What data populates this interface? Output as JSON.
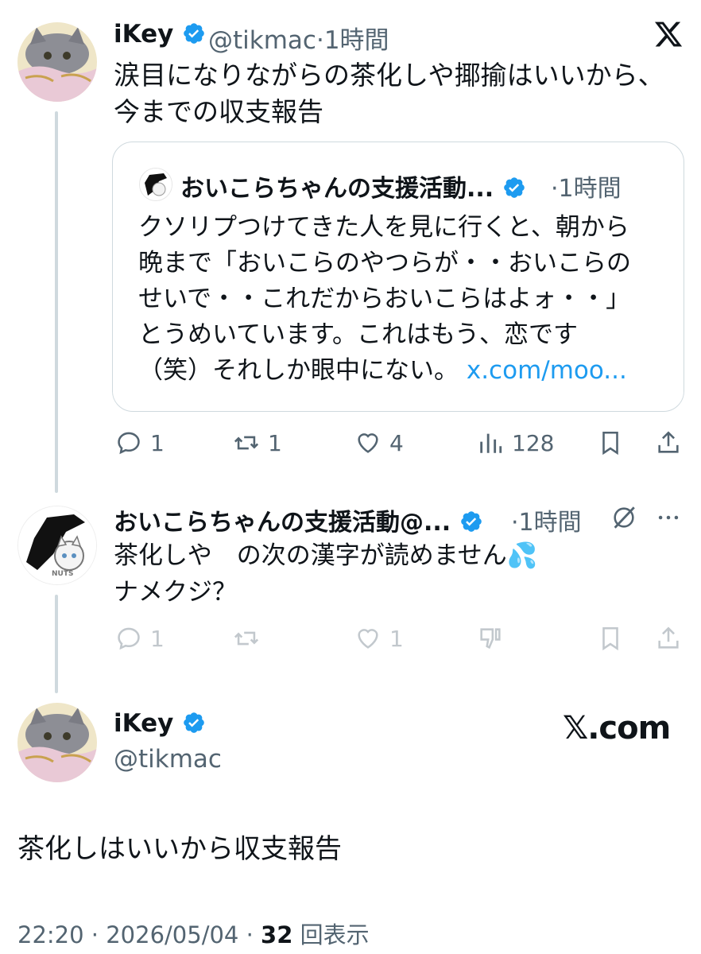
{
  "colors": {
    "verified": "#1d9bf0",
    "text": "#0f1419",
    "muted": "#536471",
    "link": "#1d9bf0",
    "thread_line": "#cfd9de"
  },
  "tweet1": {
    "name": "iKey",
    "handle": "@tikmac",
    "time": "·1時間",
    "text_line1": "涙目になりながらの茶化しや揶揄はいいから、",
    "text_line2": "今までの収支報告",
    "quote": {
      "name": "おいこらちゃんの支援活動...",
      "time": "·1時間",
      "line1": "クソリプつけてきた人を見に行くと、朝から",
      "line2": "晩まで「おいこらのやつらが・・おいこらの",
      "line3": "せいで・・これだからおいこらはよォ・・」",
      "line4": "とうめいています。これはもう、恋です",
      "line5": "（笑）それしか眼中にない。",
      "link": "x.com/moo..."
    },
    "actions": {
      "replies": "1",
      "retweets": "1",
      "likes": "4",
      "views": "128"
    }
  },
  "tweet2": {
    "name": "おいこらちゃんの支援活動@...",
    "time": "·1時間",
    "text_line1": "茶化しや　の次の漢字が読めません💦",
    "text_line2": "ナメクジ？",
    "avatar_label": "NUTS",
    "actions": {
      "replies": "1",
      "likes": "1"
    }
  },
  "tweet3": {
    "name": "iKey",
    "handle": "@tikmac",
    "brand": "𝕏.com",
    "text": "茶化しはいいから収支報告",
    "timestamp": "22:20 · 2026/05/04 · ",
    "views_count": "32",
    "views_label": " 回表示"
  },
  "icons": [
    "x-logo-icon",
    "verified-badge-icon",
    "reply-icon",
    "retweet-icon",
    "like-icon",
    "views-icon",
    "bookmark-icon",
    "share-icon",
    "more-icon",
    "grok-icon",
    "dislike-icon"
  ]
}
